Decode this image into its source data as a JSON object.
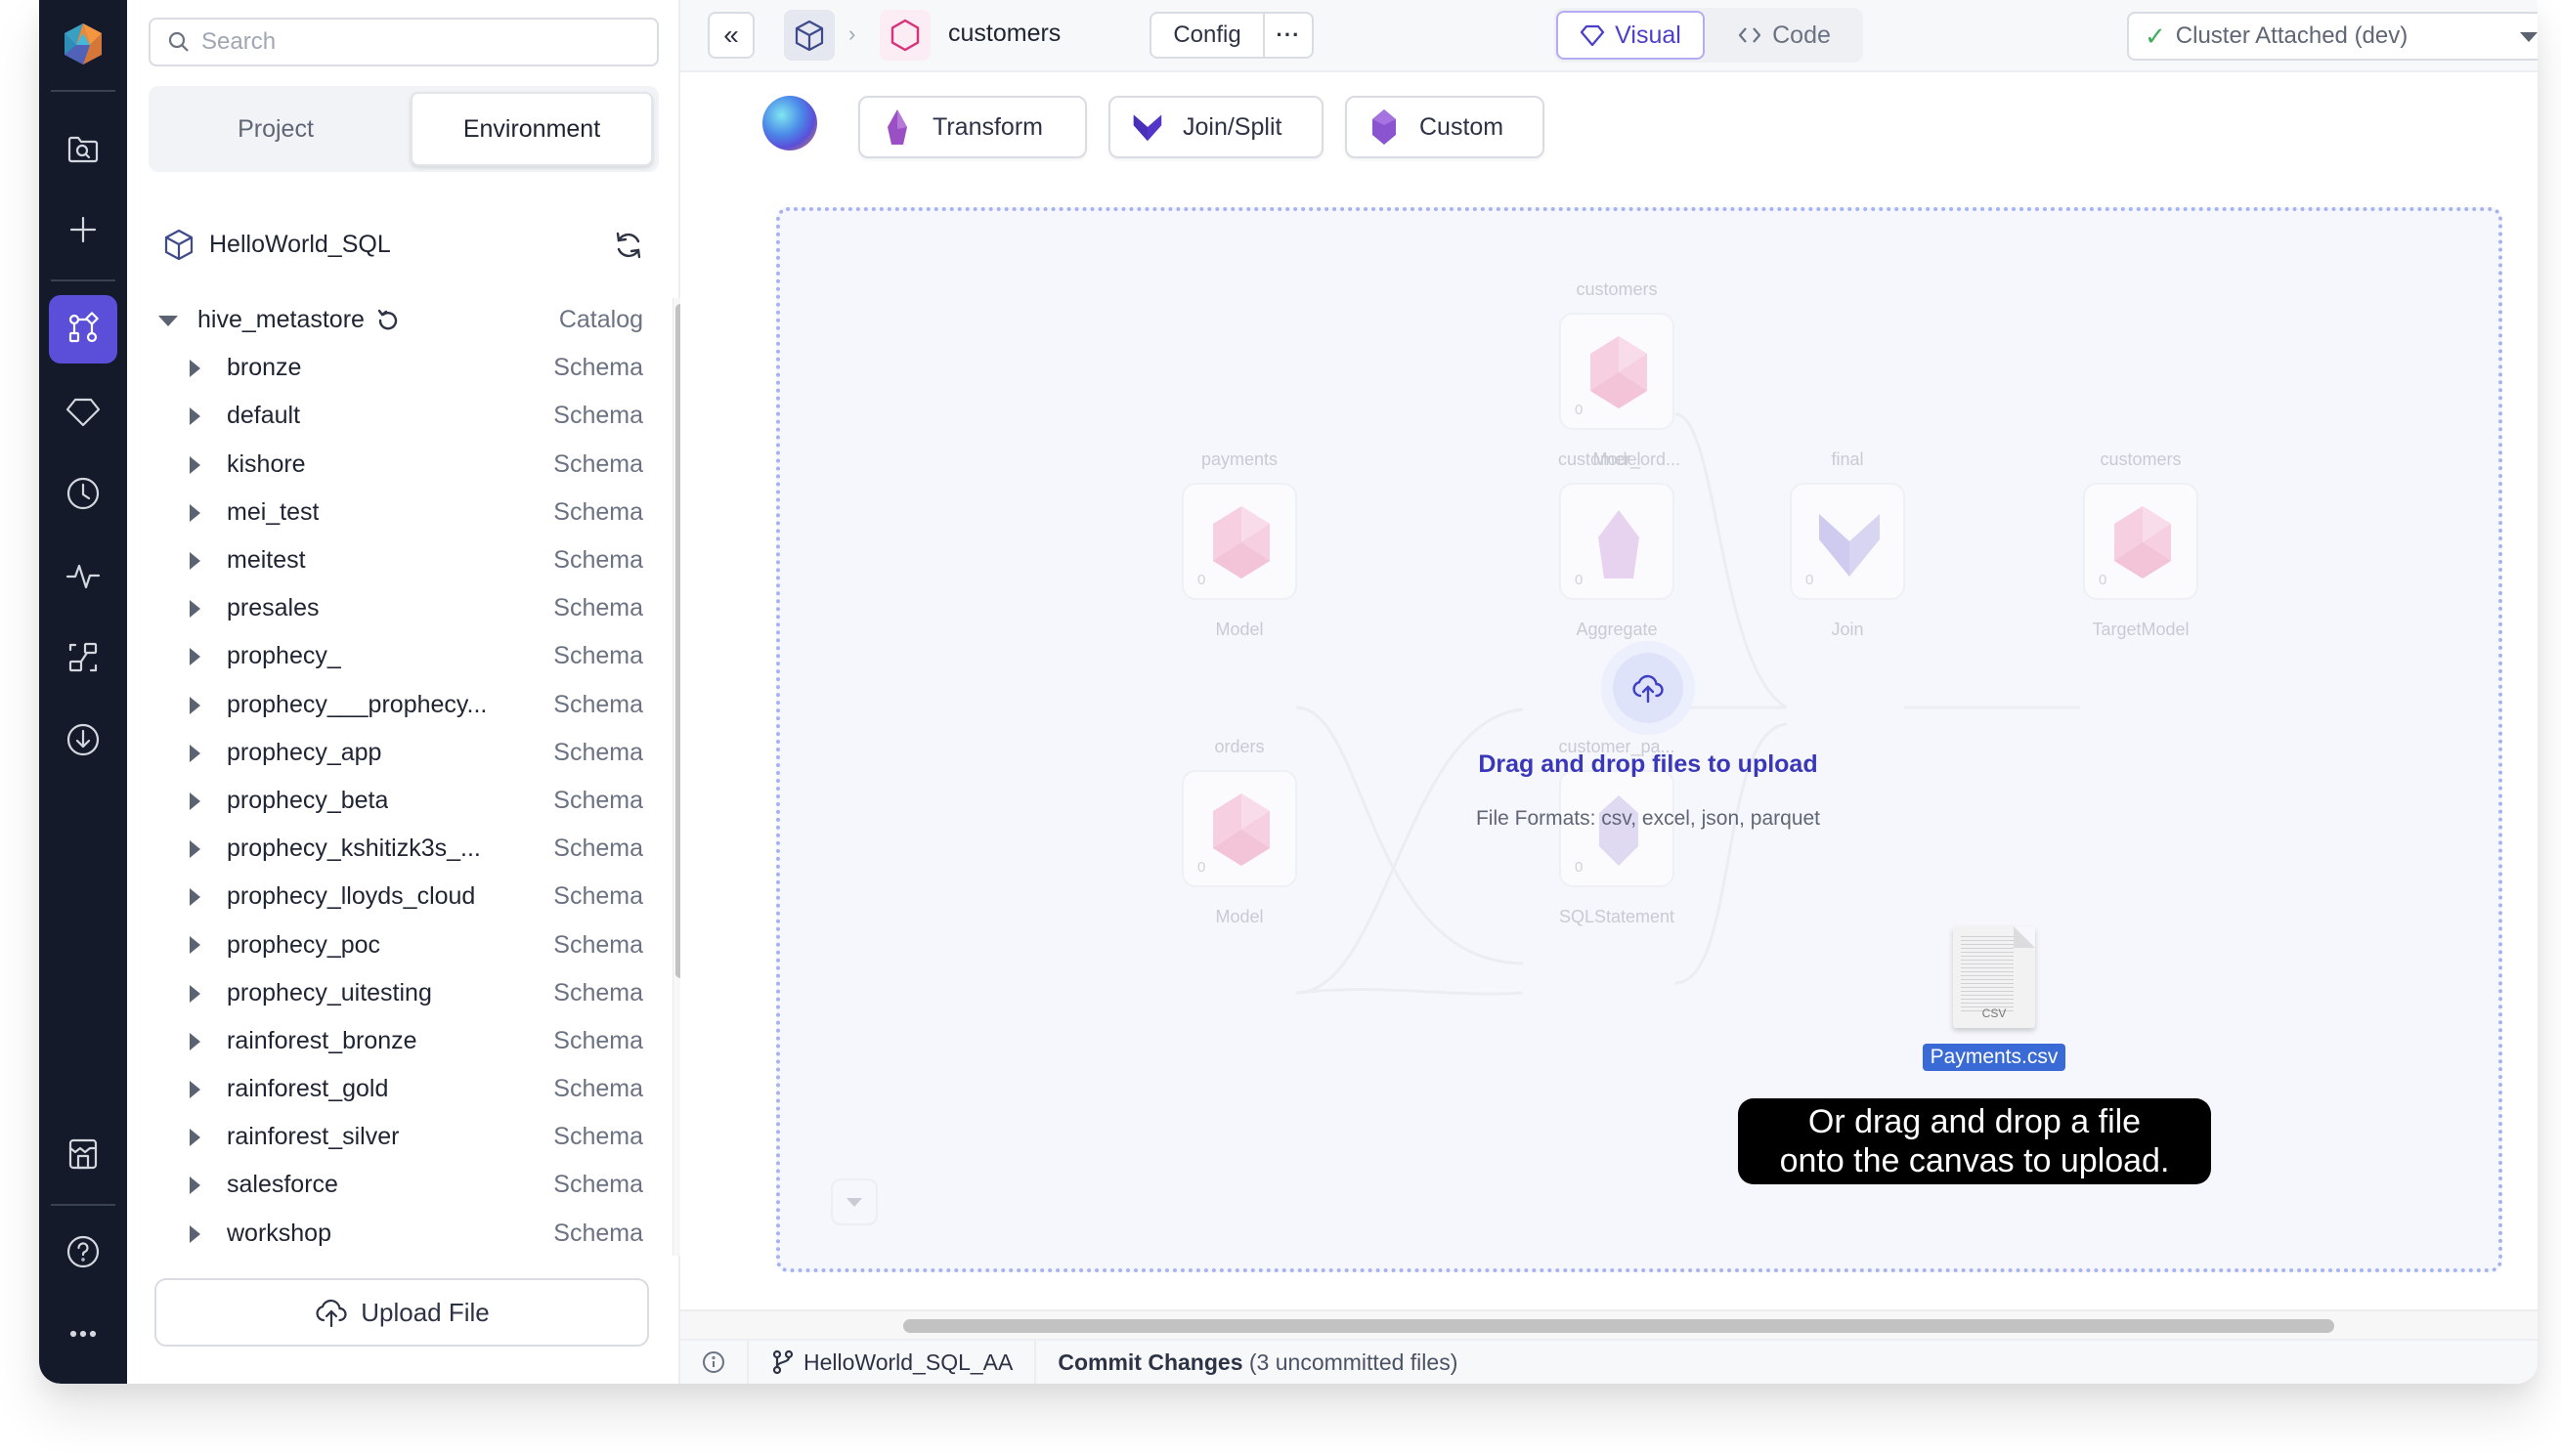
{
  "nav_rail": {
    "items": [
      {
        "icon": "folder-search-icon",
        "label": "Browse"
      },
      {
        "icon": "plus-icon",
        "label": "Create"
      },
      {
        "icon": "pipeline-graph-icon",
        "label": "Projects",
        "active": true
      },
      {
        "icon": "diamond-icon",
        "label": "Gems"
      },
      {
        "icon": "clock-icon",
        "label": "Jobs"
      },
      {
        "icon": "activity-icon",
        "label": "Observability"
      },
      {
        "icon": "lineage-icon",
        "label": "Lineage"
      },
      {
        "icon": "download-circle-icon",
        "label": "Imports"
      },
      {
        "icon": "marketplace-icon",
        "label": "Marketplace"
      },
      {
        "icon": "help-icon",
        "label": "Help"
      },
      {
        "icon": "more-icon",
        "label": "More"
      }
    ],
    "accent_color": "#5b4fd9"
  },
  "left_panel": {
    "search": {
      "placeholder": "Search",
      "value": ""
    },
    "tabs": [
      {
        "label": "Project",
        "selected": false
      },
      {
        "label": "Environment",
        "selected": true
      }
    ],
    "project_name": "HelloWorld_SQL",
    "catalog": {
      "name": "hive_metastore",
      "kind": "Catalog",
      "expanded": true
    },
    "schemas": [
      {
        "name": "bronze",
        "kind": "Schema"
      },
      {
        "name": "default",
        "kind": "Schema"
      },
      {
        "name": "kishore",
        "kind": "Schema"
      },
      {
        "name": "mei_test",
        "kind": "Schema"
      },
      {
        "name": "meitest",
        "kind": "Schema"
      },
      {
        "name": "presales",
        "kind": "Schema"
      },
      {
        "name": "prophecy_",
        "kind": "Schema"
      },
      {
        "name": "prophecy___prophecy...",
        "kind": "Schema"
      },
      {
        "name": "prophecy_app",
        "kind": "Schema"
      },
      {
        "name": "prophecy_beta",
        "kind": "Schema"
      },
      {
        "name": "prophecy_kshitizk3s_...",
        "kind": "Schema"
      },
      {
        "name": "prophecy_lloyds_cloud",
        "kind": "Schema"
      },
      {
        "name": "prophecy_poc",
        "kind": "Schema"
      },
      {
        "name": "prophecy_uitesting",
        "kind": "Schema"
      },
      {
        "name": "rainforest_bronze",
        "kind": "Schema"
      },
      {
        "name": "rainforest_gold",
        "kind": "Schema"
      },
      {
        "name": "rainforest_silver",
        "kind": "Schema"
      },
      {
        "name": "salesforce",
        "kind": "Schema"
      },
      {
        "name": "workshop",
        "kind": "Schema"
      }
    ],
    "upload_label": "Upload File"
  },
  "topbar": {
    "collapse_label": "«",
    "breadcrumb_separator": "›",
    "model_name": "customers",
    "config_label": "Config",
    "more_label": "···",
    "view_modes": [
      {
        "label": "Visual",
        "selected": true
      },
      {
        "label": "Code",
        "selected": false
      }
    ],
    "cluster": {
      "status_icon": "✓",
      "label": "Cluster Attached (dev)"
    }
  },
  "gem_toolbar": {
    "buttons": [
      {
        "label": "Transform",
        "icon": "transform-gem-icon"
      },
      {
        "label": "Join/Split",
        "icon": "join-gem-icon"
      },
      {
        "label": "Custom",
        "icon": "custom-gem-icon"
      }
    ]
  },
  "canvas": {
    "nodes": [
      {
        "id": "customers_src",
        "title": "customers",
        "type": "Model",
        "count": "0",
        "shape": "model"
      },
      {
        "id": "payments",
        "title": "payments",
        "type": "Model",
        "count": "0",
        "shape": "model"
      },
      {
        "id": "customer_ord",
        "title": "customer_ord...",
        "type": "Aggregate",
        "count": "0",
        "shape": "aggregate"
      },
      {
        "id": "final",
        "title": "final",
        "type": "Join",
        "count": "0",
        "shape": "join"
      },
      {
        "id": "customers_tgt",
        "title": "customers",
        "type": "TargetModel",
        "count": "0",
        "shape": "model"
      },
      {
        "id": "orders",
        "title": "orders",
        "type": "Model",
        "count": "0",
        "shape": "model"
      },
      {
        "id": "customer_pa",
        "title": "customer_pa...",
        "type": "SQLStatement",
        "count": "0",
        "shape": "sql"
      }
    ],
    "drop_overlay": {
      "title": "Drag and drop files to upload",
      "formats": "File Formats: csv, excel, json, parquet"
    },
    "dragged_file": {
      "name": "Payments.csv",
      "ext": "CSV"
    },
    "tooltip_line1": "Or drag and drop a file",
    "tooltip_line2": "onto the canvas to upload."
  },
  "statusbar": {
    "branch": "HelloWorld_SQL_AA",
    "commit_label": "Commit Changes",
    "commit_detail": "(3 uncommitted files)"
  }
}
